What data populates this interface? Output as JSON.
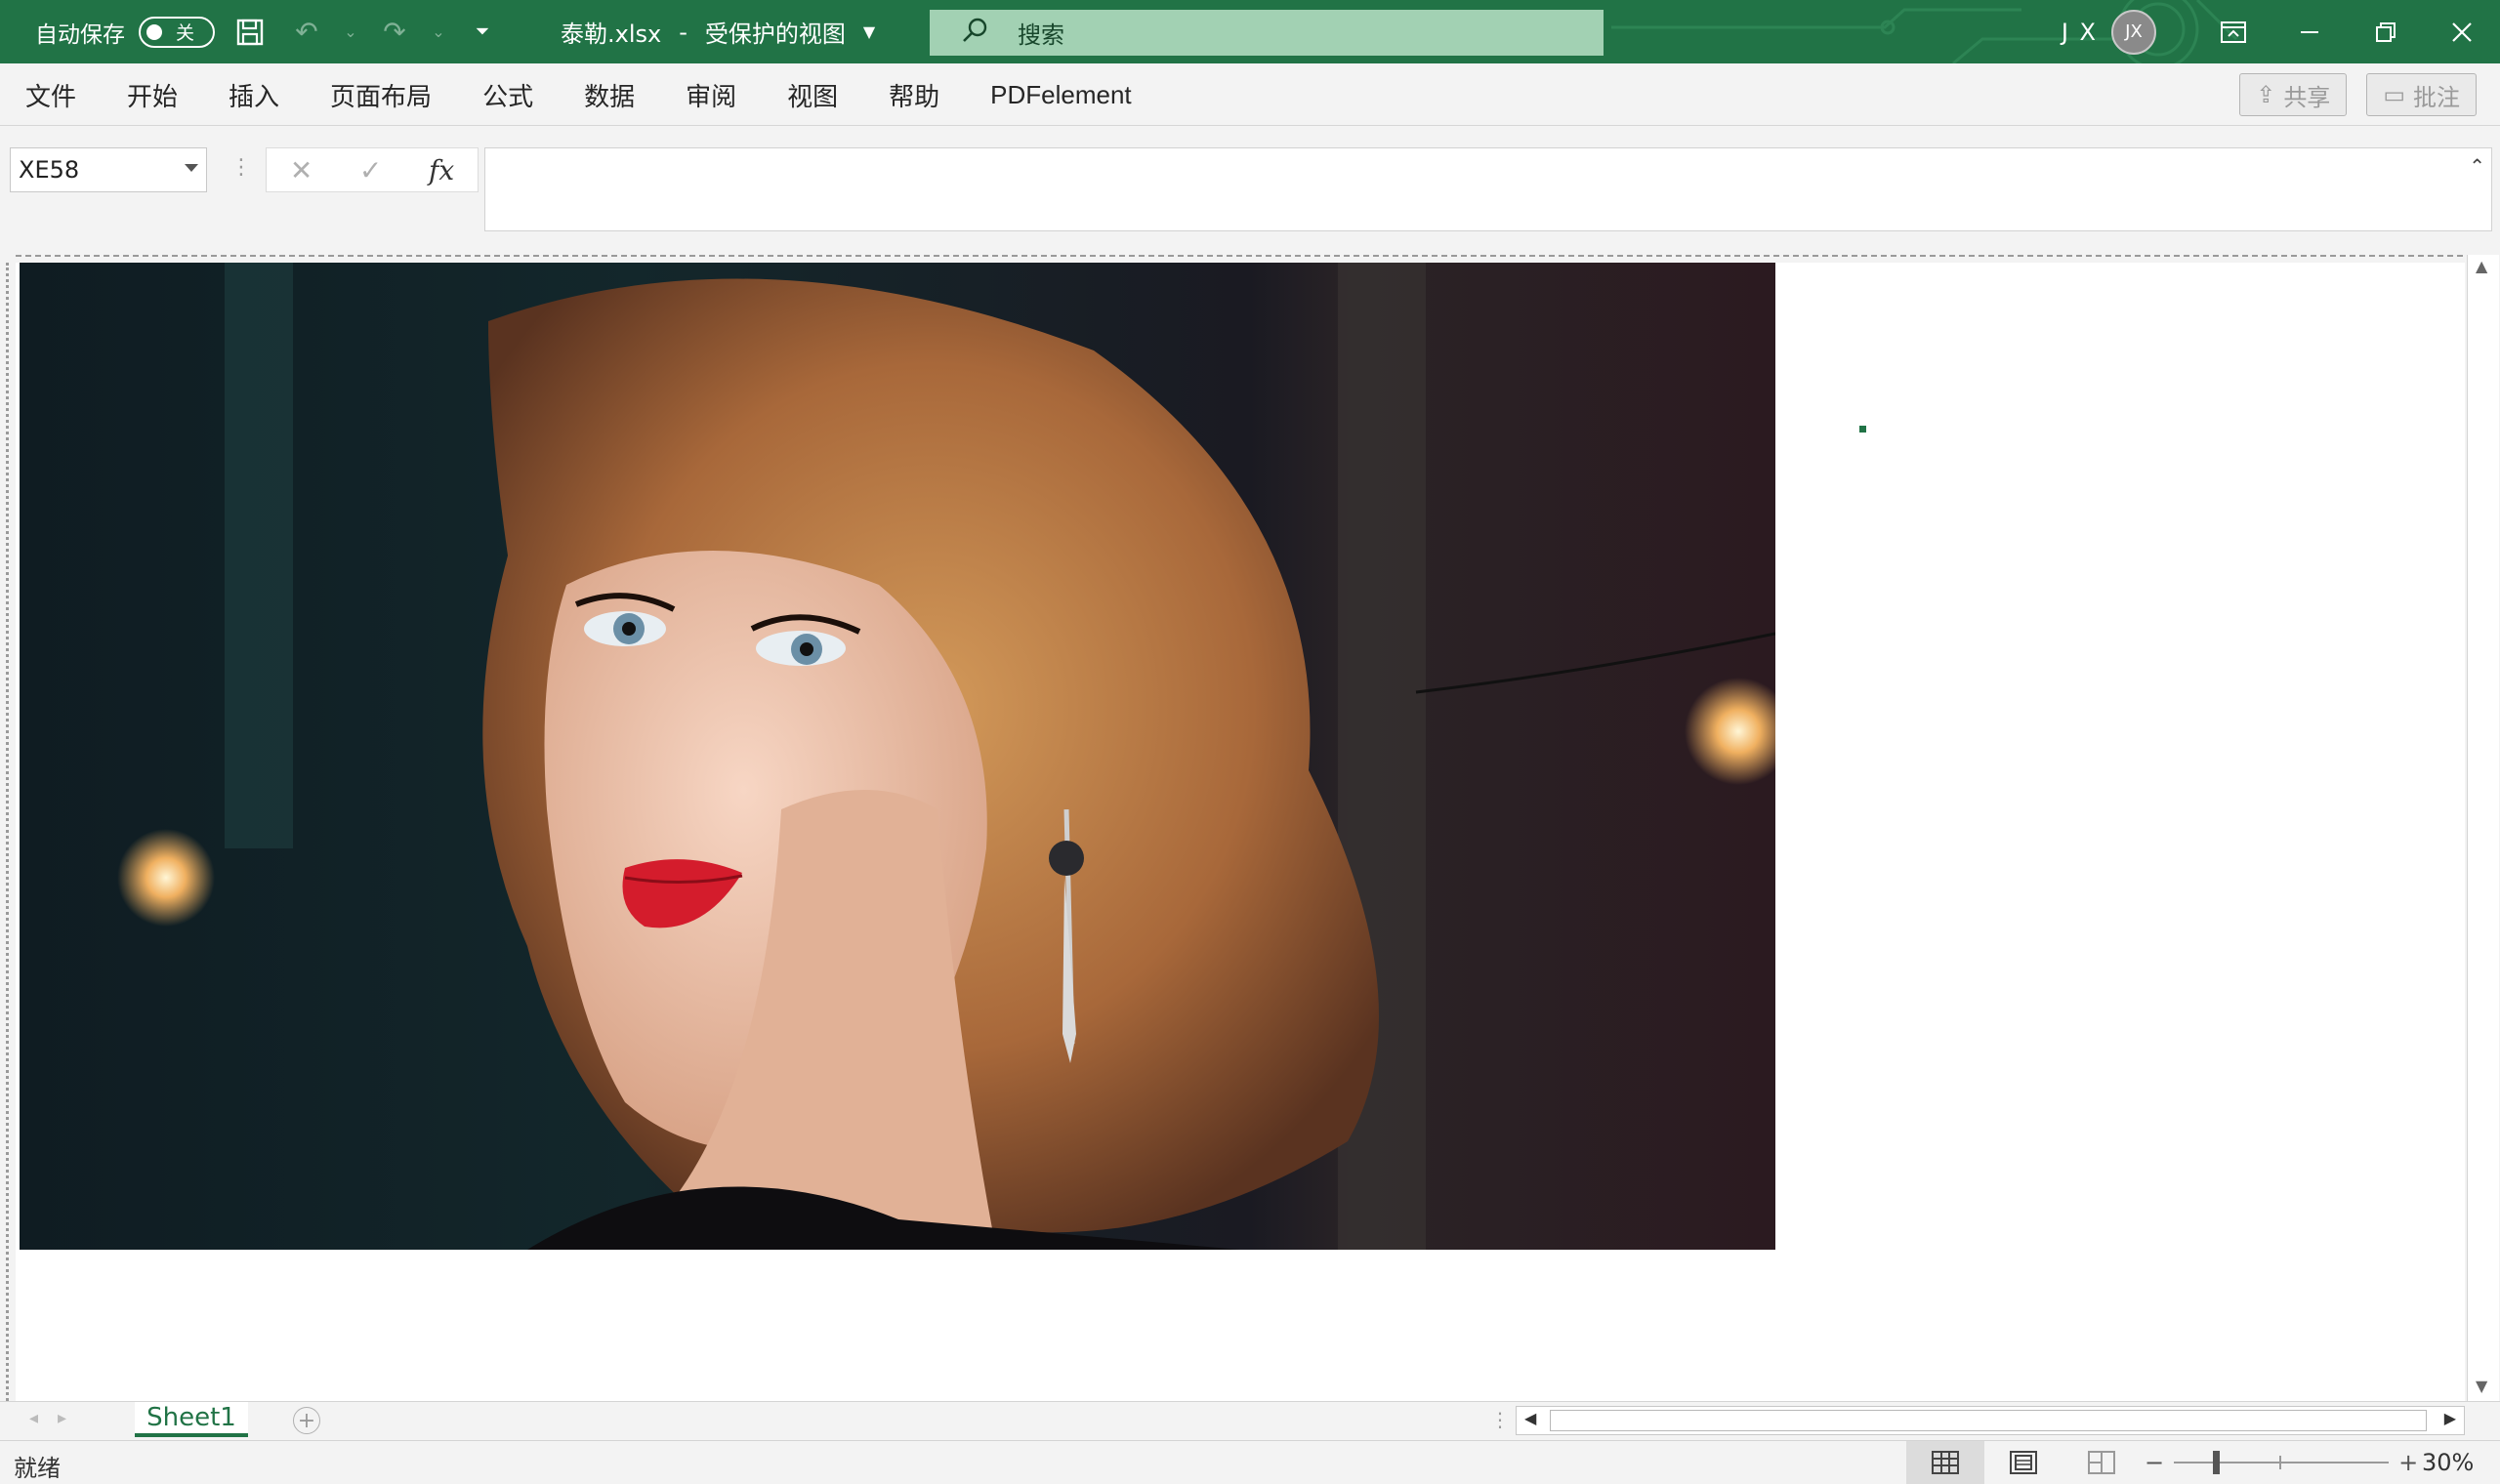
{
  "titlebar": {
    "autosave_label": "自动保存",
    "autosave_state": "关",
    "document_title": "泰勒.xlsx",
    "separator": "-",
    "view_mode": "受保护的视图",
    "search_placeholder": "搜索",
    "user_initials": "J X",
    "avatar_initials": "JX",
    "colors": {
      "background": "#217346",
      "search_box": "#a2d1b3"
    }
  },
  "menu": {
    "items": [
      "文件",
      "开始",
      "插入",
      "页面布局",
      "公式",
      "数据",
      "审阅",
      "视图",
      "帮助",
      "PDFelement"
    ],
    "share_label": "共享",
    "comments_label": "批注"
  },
  "formula_bar": {
    "name_box": "XE58",
    "fx_symbol": "fx",
    "formula_value": ""
  },
  "sheet": {
    "image": "portrait photo of a woman with shoulder-length wavy blonde hair and red lipstick",
    "tabs": [
      "Sheet1"
    ],
    "active_tab": "Sheet1"
  },
  "statusbar": {
    "status": "就绪",
    "zoom_level": "30%",
    "zoom_minus": "−",
    "zoom_plus": "+"
  }
}
